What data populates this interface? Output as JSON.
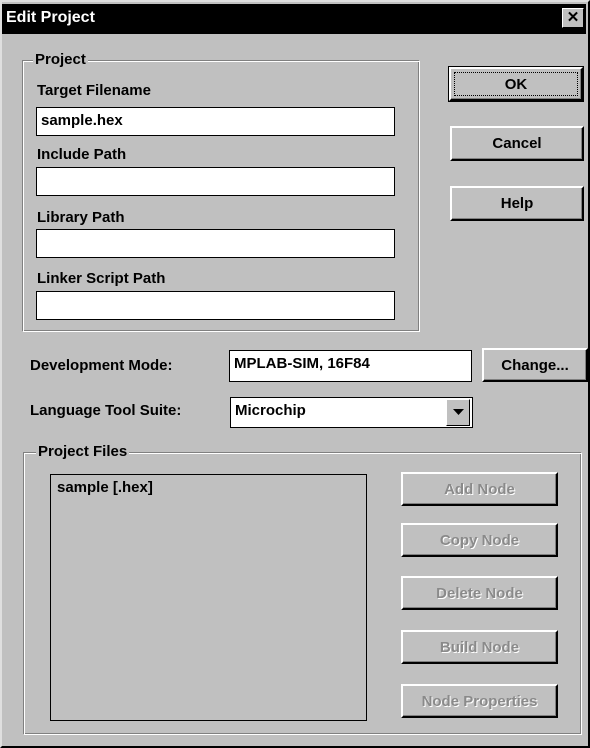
{
  "window": {
    "title": "Edit Project",
    "close_label": "✕"
  },
  "project_group": {
    "legend": "Project",
    "target_filename": {
      "label": "Target Filename",
      "value": "sample.hex"
    },
    "include_path": {
      "label": "Include Path",
      "value": ""
    },
    "library_path": {
      "label": "Library Path",
      "value": ""
    },
    "linker_script_path": {
      "label": "Linker Script Path",
      "value": ""
    }
  },
  "buttons": {
    "ok": "OK",
    "cancel": "Cancel",
    "help": "Help",
    "change": "Change..."
  },
  "development_mode": {
    "label": "Development Mode:",
    "value": "MPLAB-SIM, 16F84"
  },
  "language_tool_suite": {
    "label": "Language Tool Suite:",
    "selected": "Microchip"
  },
  "project_files": {
    "legend": "Project Files",
    "items": [
      "sample [.hex]"
    ],
    "buttons": {
      "add_node": "Add Node",
      "copy_node": "Copy Node",
      "delete_node": "Delete Node",
      "build_node": "Build Node",
      "node_properties": "Node Properties"
    }
  }
}
